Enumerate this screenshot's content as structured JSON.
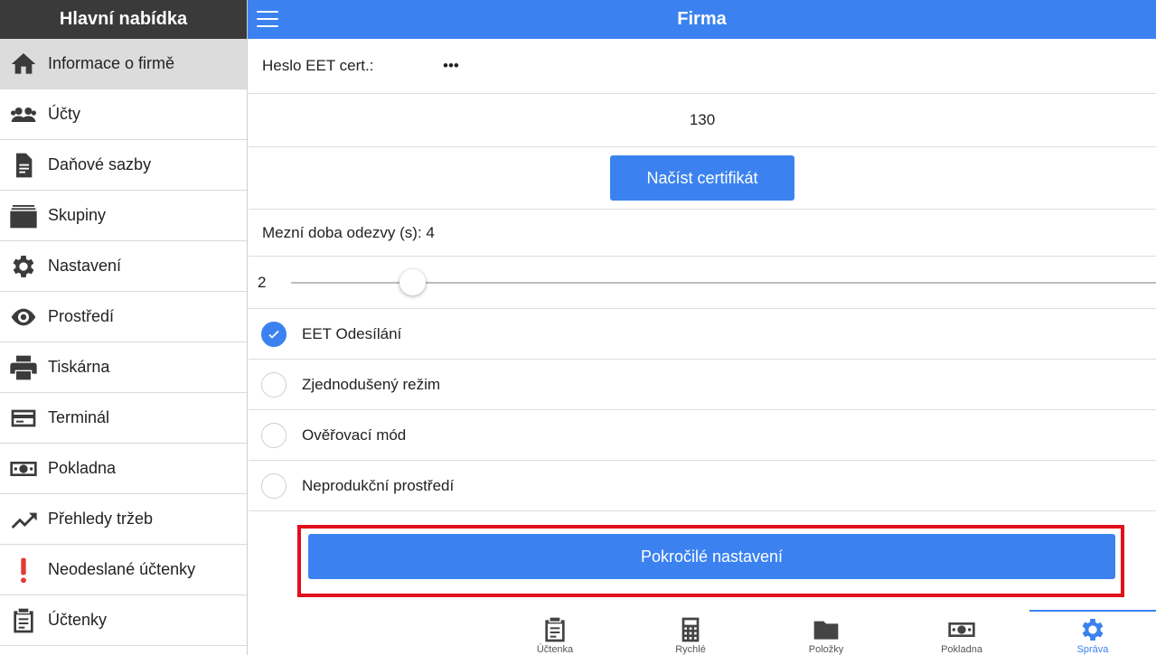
{
  "sidebar": {
    "title": "Hlavní nabídka",
    "items": [
      {
        "label": "Informace o firmě",
        "icon": "home-icon",
        "active": true
      },
      {
        "label": "Účty",
        "icon": "users-icon"
      },
      {
        "label": "Daňové sazby",
        "icon": "document-icon"
      },
      {
        "label": "Skupiny",
        "icon": "folder-stack-icon"
      },
      {
        "label": "Nastavení",
        "icon": "gear-icon"
      },
      {
        "label": "Prostředí",
        "icon": "eye-icon"
      },
      {
        "label": "Tiskárna",
        "icon": "printer-icon"
      },
      {
        "label": "Terminál",
        "icon": "credit-card-icon"
      },
      {
        "label": "Pokladna",
        "icon": "cash-icon"
      },
      {
        "label": "Přehledy tržeb",
        "icon": "trending-up-icon"
      },
      {
        "label": "Neodeslané účtenky",
        "icon": "exclamation-icon"
      },
      {
        "label": "Účtenky",
        "icon": "clipboard-icon"
      }
    ]
  },
  "topbar": {
    "title": "Firma",
    "menu_icon": "hamburger-menu-icon"
  },
  "main": {
    "cert_password_label": "Heslo EET cert.:",
    "cert_password_value": "123",
    "number_value": "130",
    "load_cert_label": "Načíst certifikát",
    "timeout_label": "Mezní doba odezvy (s): 4",
    "slider_value": "2",
    "slider_level": 0.14,
    "options": [
      {
        "label": "EET Odesílání",
        "checked": true
      },
      {
        "label": "Zjednodušený režim",
        "checked": false
      },
      {
        "label": "Ověřovací mód",
        "checked": false
      },
      {
        "label": "Neprodukční prostředí",
        "checked": false
      }
    ],
    "advanced_label": "Pokročilé nastavení"
  },
  "bottom_nav": {
    "items": [
      {
        "label": "Účtenka",
        "icon": "receipt-icon"
      },
      {
        "label": "Rychlé",
        "icon": "calculator-icon"
      },
      {
        "label": "Položky",
        "icon": "folder-icon"
      },
      {
        "label": "Pokladna",
        "icon": "cash-icon"
      },
      {
        "label": "Správa",
        "icon": "gear-icon",
        "active": true
      }
    ]
  },
  "colors": {
    "accent": "#3b82f0",
    "sidebar_header": "#3a3a3a",
    "highlight_border": "#e0101c",
    "active_item": "#dcdcdc"
  }
}
